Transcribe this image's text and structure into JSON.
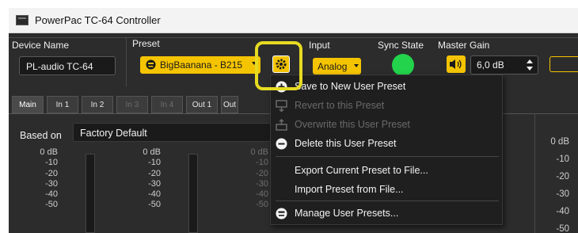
{
  "window": {
    "title": "PowerPac TC-64 Controller"
  },
  "device": {
    "label": "Device Name",
    "value": "PL-audio TC-64"
  },
  "preset": {
    "label": "Preset",
    "value": "BigBaanana - B215",
    "dropdown_icon": "triangle-down-icon",
    "settings_icon": "gear-icon"
  },
  "input": {
    "label": "Input",
    "value": "Analog",
    "dropdown_icon": "triangle-down-icon"
  },
  "sync": {
    "label": "Sync State",
    "status_color": "#22d34b"
  },
  "master": {
    "label": "Master Gain",
    "value": "6,0 dB",
    "speaker_icon": "speaker-icon",
    "stepper_icon": "up-down-arrows-icon"
  },
  "tabs": [
    {
      "label": "Main",
      "state": "active"
    },
    {
      "label": "In 1",
      "state": "normal"
    },
    {
      "label": "In 2",
      "state": "normal"
    },
    {
      "label": "In 3",
      "state": "disabled"
    },
    {
      "label": "In 4",
      "state": "disabled"
    },
    {
      "label": "Out 1",
      "state": "normal"
    },
    {
      "label": "Out",
      "state": "normal"
    }
  ],
  "based_on": {
    "label": "Based on",
    "value": "Factory Default"
  },
  "meter_scale": [
    "0 dB",
    "-10",
    "-20",
    "-30",
    "-40",
    "-50"
  ],
  "meter_partial_scale": [
    "0 dB",
    "-10",
    "-20",
    "-30",
    "-40",
    "-50"
  ],
  "right_meter_scale": [
    "0 dB",
    "-10",
    "-20",
    "-30",
    "-40",
    "-50"
  ],
  "context_menu": {
    "items": [
      {
        "label": "Save to New User Preset",
        "icon": "plus-circle-icon",
        "enabled": true
      },
      {
        "label": "Revert to this Preset",
        "icon": "revert-icon",
        "enabled": false
      },
      {
        "label": "Overwrite this User Preset",
        "icon": "overwrite-icon",
        "enabled": false
      },
      {
        "label": "Delete this User Preset",
        "icon": "minus-circle-icon",
        "enabled": true
      },
      {
        "label": "Export Current Preset to File...",
        "icon": "",
        "enabled": true
      },
      {
        "label": "Import Preset from File...",
        "icon": "",
        "enabled": true
      },
      {
        "label": "Manage User Presets...",
        "icon": "smiley-icon",
        "enabled": true
      }
    ]
  },
  "colors": {
    "accent": "#f5c400",
    "highlight_ring": "#e6db22",
    "background": "#2c2c2c"
  }
}
